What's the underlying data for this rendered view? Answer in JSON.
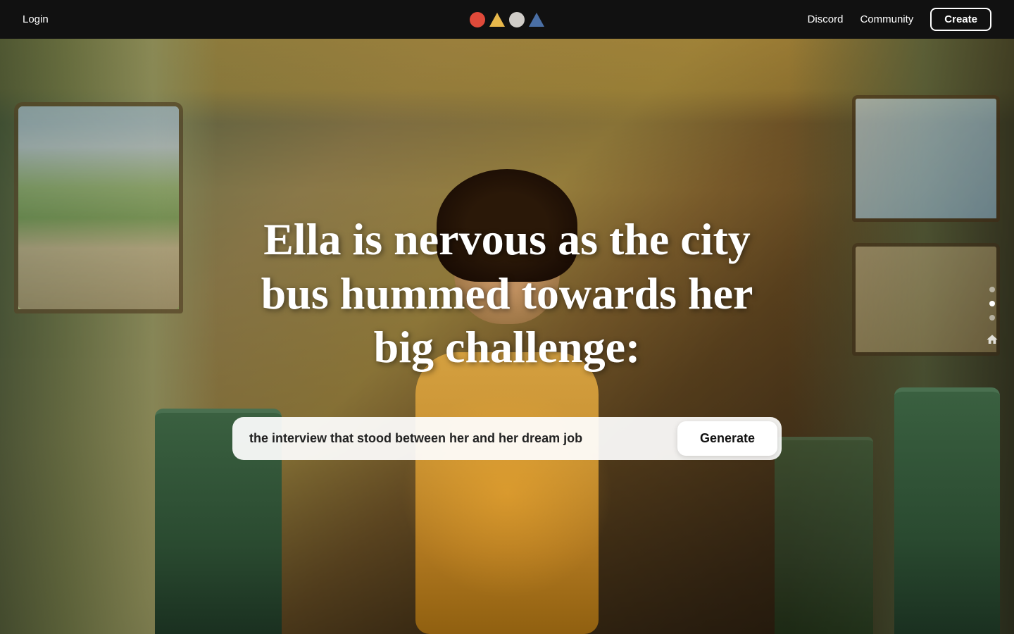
{
  "navbar": {
    "login_label": "Login",
    "discord_label": "Discord",
    "community_label": "Community",
    "create_label": "Create",
    "logo_icons": [
      "red-circle",
      "yellow-triangle",
      "white-circle",
      "blue-triangle"
    ]
  },
  "hero": {
    "title_line1": "Ella is nervous as the city bus",
    "title_line2": "hummed towards her big",
    "title_line3": "challenge:",
    "title_full": "Ella is nervous as the city bus hummed towards her big challenge:",
    "input_value": "the interview that stood between her and her dream job",
    "generate_label": "Generate"
  },
  "dot_nav": {
    "dots": [
      {
        "active": false
      },
      {
        "active": true
      },
      {
        "active": false
      }
    ],
    "home_icon": "🏠"
  },
  "colors": {
    "navbar_bg": "#111111",
    "text_primary": "#ffffff",
    "input_bg": "rgba(255,255,255,0.92)",
    "btn_bg": "#ffffff",
    "logo_red": "#e04a3a",
    "logo_yellow": "#e8b84b",
    "logo_white": "#d0cdc8",
    "logo_blue": "#4a6fa5"
  }
}
